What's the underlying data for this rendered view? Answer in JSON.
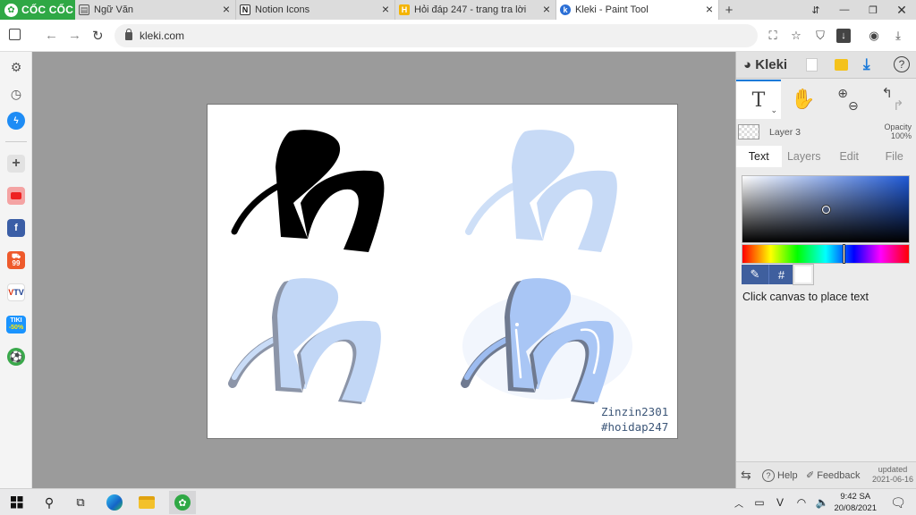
{
  "browser": {
    "brand": "CỐC CỐC",
    "tabs": [
      {
        "title": "Ngữ Văn",
        "active": false
      },
      {
        "title": "Notion Icons",
        "active": false
      },
      {
        "title": "Hỏi đáp 247 - trang tra lời",
        "active": false
      },
      {
        "title": "Kleki - Paint Tool",
        "active": true
      }
    ],
    "new_tab": "+",
    "address": "kleki.com"
  },
  "sidebar": {
    "icons": [
      "panel-icon",
      "settings-icon",
      "history-icon",
      "messenger-icon",
      "add-icon",
      "youtube-icon",
      "facebook-icon",
      "shopee-icon",
      "vtv-icon",
      "tiki-icon",
      "soccer-icon"
    ],
    "tiki_badge": "-50%",
    "shopee_badge": "99"
  },
  "canvas": {
    "watermark_line1": "Zinzin2301",
    "watermark_line2": "#hoidap247"
  },
  "panel": {
    "logo": "Kleki",
    "layer_name": "Layer 3",
    "opacity_label": "Opacity",
    "opacity_value": "100%",
    "tabs": [
      "Text",
      "Layers",
      "Edit",
      "File"
    ],
    "active_tab": "Text",
    "hex_label": "#",
    "hint": "Click canvas to place text",
    "help": "Help",
    "feedback": "Feedback",
    "updated_label": "updated",
    "updated_date": "2021-06-16",
    "colors": {
      "accent": "#1a7ad9",
      "text_tool_tab": "#ffffff"
    }
  },
  "taskbar": {
    "time": "9:42 SA",
    "date": "20/08/2021"
  }
}
